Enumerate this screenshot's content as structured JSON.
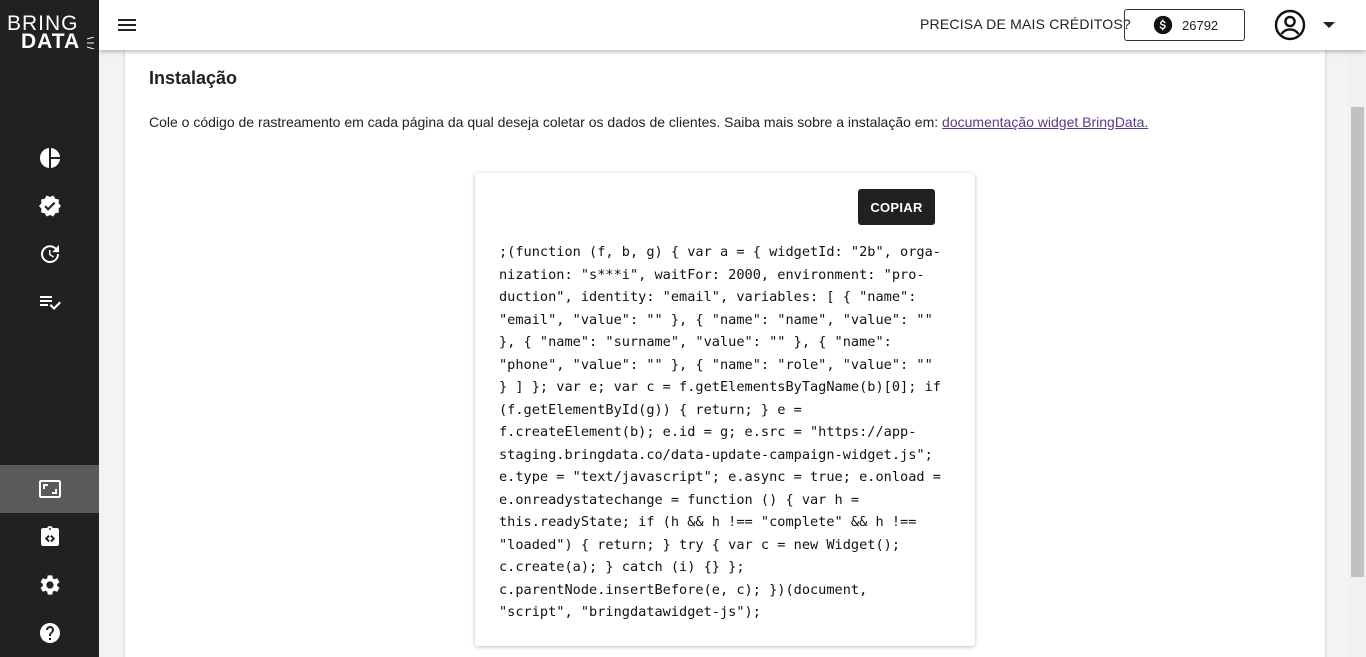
{
  "brand": {
    "line1": "BRING",
    "line2": "DATA"
  },
  "sidebar": {
    "items": [
      {
        "name": "sidebar-item-dashboard",
        "icon": "pie-chart-icon",
        "active": false
      },
      {
        "name": "sidebar-item-verified",
        "icon": "verified-badge-icon",
        "active": false
      },
      {
        "name": "sidebar-item-history",
        "icon": "update-history-icon",
        "active": false
      },
      {
        "name": "sidebar-item-lists",
        "icon": "playlist-check-icon",
        "active": false
      },
      {
        "name": "sidebar-item-widget",
        "icon": "aspect-ratio-icon",
        "active": true
      },
      {
        "name": "sidebar-item-integration",
        "icon": "code-clipboard-icon",
        "active": false
      },
      {
        "name": "sidebar-item-settings",
        "icon": "gear-icon",
        "active": false
      },
      {
        "name": "sidebar-item-help",
        "icon": "help-icon",
        "active": false
      }
    ]
  },
  "header": {
    "credits_question": "PRECISA DE MAIS CRÉDITOS?",
    "credits_amount": "26792"
  },
  "main": {
    "title": "Instalação",
    "description": "Cole o código de rastreamento em cada página da qual deseja coletar os dados de clientes. Saiba mais sobre a instalação em: ",
    "doc_link": "documentação widget BringData.",
    "copy_label": "COPIAR",
    "code_lines": [
      ";(function (f, b, g) { var a = { widgetId: \"2b\", orga-",
      "nization: \"s***i\", waitFor: 2000, environment: \"pro-",
      "duction\", identity: \"email\", variables: [ { \"name\":",
      "\"email\", \"value\": \"\" }, { \"name\": \"name\", \"value\": \"\"",
      "}, { \"name\": \"surname\", \"value\": \"\" }, { \"name\":",
      "\"phone\", \"value\": \"\" }, { \"name\": \"role\", \"value\": \"\"",
      "} ] }; var e; var c = f.getElementsByTagName(b)[0]; if",
      "(f.getElementById(g)) { return; } e =",
      "f.createElement(b); e.id = g; e.src = \"https://app-",
      "staging.bringdata.co/data-update-campaign-widget.js\";",
      "e.type = \"text/javascript\"; e.async = true; e.onload =",
      "e.onreadystatechange = function () { var h =",
      "this.readyState; if (h && h !== \"complete\" && h !==",
      "\"loaded\") { return; } try { var c = new Widget();",
      "c.create(a); } catch (i) {} };",
      "c.parentNode.insertBefore(e, c); })(document,",
      "\"script\", \"bringdatawidget-js\");"
    ]
  },
  "colors": {
    "sidebar_bg": "#212121",
    "sidebar_active": "#5a5a5a",
    "link": "#5b3a86",
    "button_bg": "#212121"
  }
}
